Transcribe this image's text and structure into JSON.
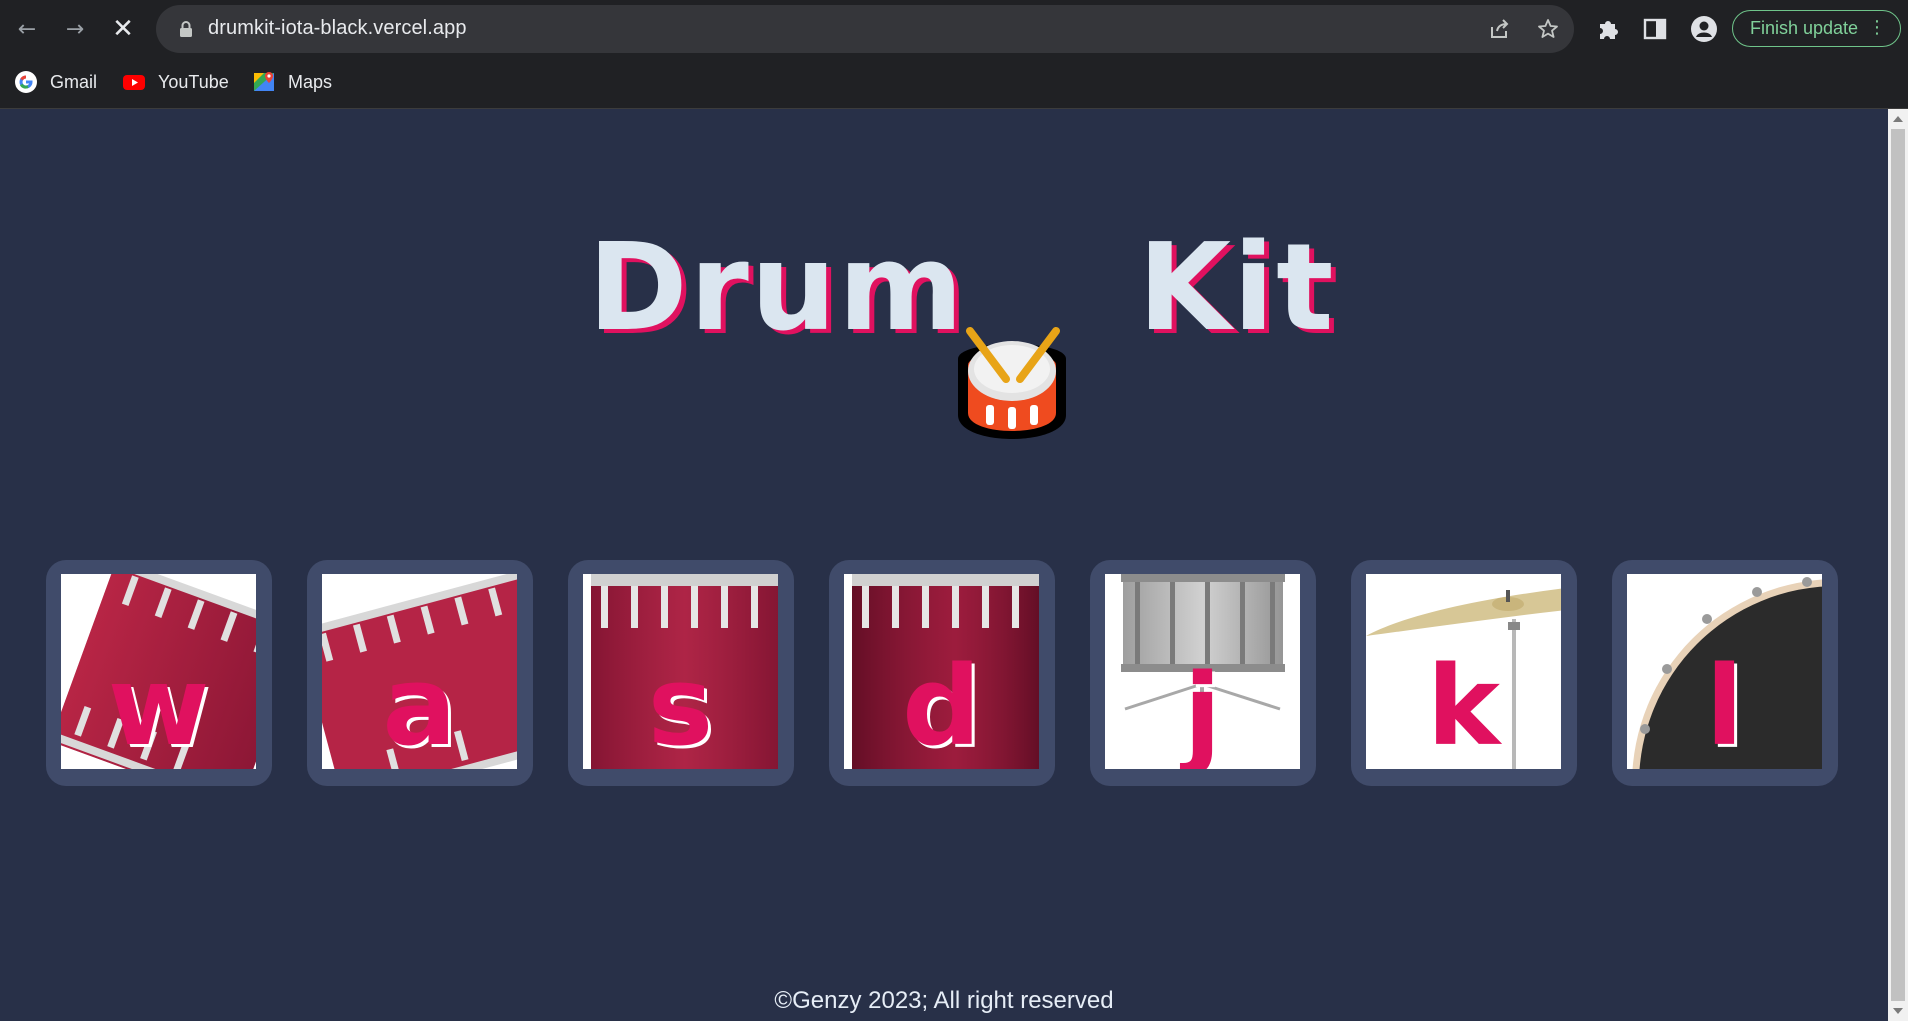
{
  "browser": {
    "url": "drumkit-iota-black.vercel.app",
    "finish_update_label": "Finish update",
    "bookmarks": [
      {
        "label": "Gmail",
        "icon": "google-icon"
      },
      {
        "label": "YouTube",
        "icon": "youtube-icon"
      },
      {
        "label": "Maps",
        "icon": "maps-icon"
      }
    ]
  },
  "page": {
    "title_left": "Drum",
    "title_right": "Kit",
    "keys": [
      {
        "letter": "w",
        "image": "tom-1"
      },
      {
        "letter": "a",
        "image": "tom-2"
      },
      {
        "letter": "s",
        "image": "tom-3"
      },
      {
        "letter": "d",
        "image": "tom-4"
      },
      {
        "letter": "j",
        "image": "snare"
      },
      {
        "letter": "k",
        "image": "crash"
      },
      {
        "letter": "l",
        "image": "kick"
      }
    ],
    "footer": "©Genzy 2023; All right reserved"
  },
  "colors": {
    "background": "#283048",
    "key_frame": "#404b6a",
    "accent": "#e0115f",
    "title_text": "#dbe6f0"
  }
}
